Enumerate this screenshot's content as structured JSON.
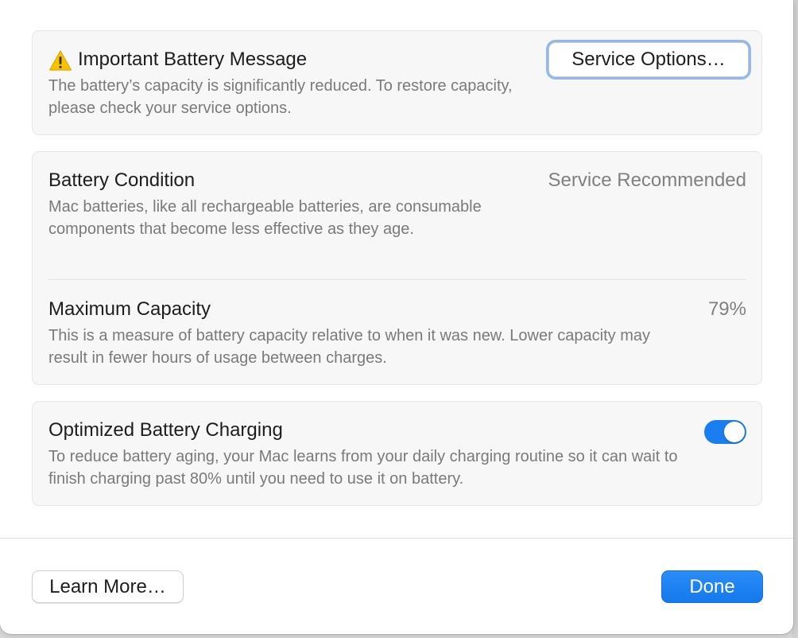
{
  "message": {
    "title": "Important Battery Message",
    "description": "The battery’s capacity is significantly reduced. To restore capacity, please check your service options.",
    "service_button": "Service Options…",
    "icon": "warning-icon"
  },
  "battery": {
    "condition": {
      "title": "Battery Condition",
      "value": "Service Recommended",
      "description": "Mac batteries, like all rechargeable batteries, are consumable components that become less effective as they age."
    },
    "capacity": {
      "title": "Maximum Capacity",
      "value": "79%",
      "description": "This is a measure of battery capacity relative to when it was new. Lower capacity may result in fewer hours of usage between charges."
    }
  },
  "charging": {
    "title": "Optimized Battery Charging",
    "description": "To reduce battery aging, your Mac learns from your daily charging routine so it can wait to finish charging past 80% until you need to use it on battery.",
    "enabled": true
  },
  "footer": {
    "learn_more": "Learn More…",
    "done": "Done"
  },
  "colors": {
    "accent": "#1a7df0",
    "warning": "#f5c400"
  }
}
